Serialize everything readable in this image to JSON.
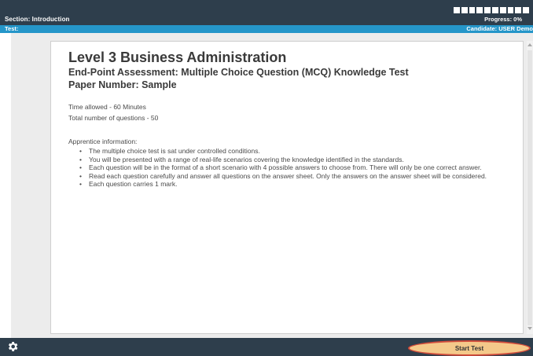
{
  "header": {
    "section": "Section: Introduction",
    "progress": "Progress: 0%",
    "progress_fraction": 0,
    "test": "Test:",
    "candidate": "Candidate: USER Demo"
  },
  "content": {
    "title": "Level 3 Business Administration",
    "subtitle": "End-Point Assessment: Multiple Choice Question (MCQ) Knowledge Test",
    "paper": "Paper Number: Sample",
    "time_allowed": "Time allowed - 60 Minutes",
    "total_questions": "Total number of questions - 50",
    "apprentice_heading": "Apprentice information:",
    "bullets": [
      "The multiple choice test is sat under controlled conditions.",
      "You will be presented with a range of real-life scenarios covering the knowledge identified in the standards.",
      "Each question will be in the format of a short scenario with 4 possible answers to choose from.  There will only be one correct answer.",
      "Read each question carefully and answer all questions on the answer sheet.  Only the answers on the answer sheet will be considered.",
      "Each question carries 1 mark."
    ]
  },
  "footer": {
    "start_label": "Start Test",
    "settings_icon": "gear-icon"
  },
  "colors": {
    "header_bg": "#2e3e4c",
    "subbar_bg": "#2596c9",
    "start_button_bg": "#f4c98a",
    "highlight_ring": "#d04b3b"
  }
}
